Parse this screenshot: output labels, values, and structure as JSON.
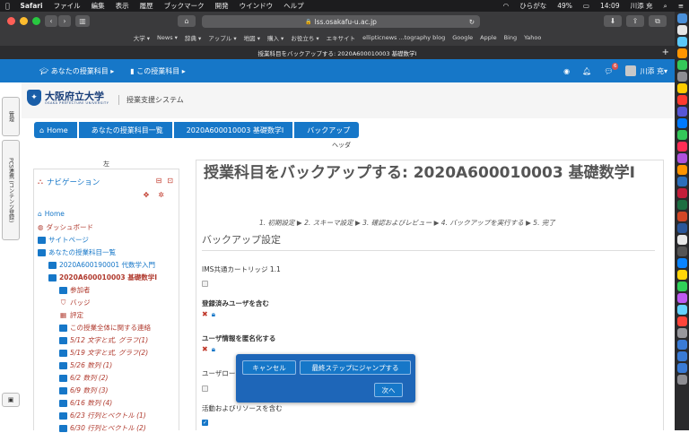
{
  "menubar": {
    "apple": "",
    "items": [
      "Safari",
      "ファイル",
      "編集",
      "表示",
      "履歴",
      "ブックマーク",
      "開発",
      "ウインドウ",
      "ヘルプ"
    ],
    "status": {
      "input": "ひらがな",
      "battery": "49%",
      "time": "14:09",
      "user": "川添 充"
    }
  },
  "browser": {
    "url": "lss.osakafu-u.ac.jp",
    "favorites": [
      "大学 ▾",
      "News ▾",
      "辞典 ▾",
      "アップル ▾",
      "地図 ▾",
      "購入 ▾",
      "お役立ち ▾",
      "エキサイト",
      "ellipticnews ...tography blog",
      "Google",
      "Apple",
      "Bing",
      "Yahoo"
    ],
    "tab_title": "授業科目をバックアップする: 2020A600010003 基礎数学I"
  },
  "navbar": {
    "my_courses": "あなたの授業科目",
    "this_course": "この授業科目",
    "message_badge": "6",
    "user": "川添 充"
  },
  "sidetabs": {
    "tab1": "管理",
    "tab2": "PCS連携 (コンテンツ登録)"
  },
  "site": {
    "logo_jp": "大阪府立大学",
    "logo_en": "OSAKA PREFECTURE UNIVERSITY",
    "system_name": "授業支援システム"
  },
  "breadcrumb": [
    "Home",
    "あなたの授業科目一覧",
    "2020A600010003 基礎数学I",
    "バックアップ"
  ],
  "labels": {
    "header": "ヘッダ",
    "left": "左"
  },
  "navigation": {
    "title": "ナビゲーション",
    "items": [
      {
        "label": "Home"
      },
      {
        "label": "ダッシュボード"
      },
      {
        "label": "サイトページ"
      },
      {
        "label": "あなたの授業科目一覧"
      },
      {
        "label": "2020A600190001 代数学入門"
      },
      {
        "label": "2020A600010003 基礎数学I"
      },
      {
        "label": "参加者"
      },
      {
        "label": "バッジ"
      },
      {
        "label": "評定"
      },
      {
        "label": "この授業全体に関する連絡"
      },
      {
        "label": "5/12 文字と式, グラフ(1)"
      },
      {
        "label": "5/19 文字と式, グラフ(2)"
      },
      {
        "label": "5/26 数列 (1)"
      },
      {
        "label": "6/2 数列 (2)"
      },
      {
        "label": "6/9 数列 (3)"
      },
      {
        "label": "6/16 数列 (4)"
      },
      {
        "label": "6/23 行列とベクトル (1)"
      },
      {
        "label": "6/30 行列とベクトル (2)"
      }
    ]
  },
  "main": {
    "title": "授業科目をバックアップする: 2020A600010003 基礎数学I",
    "steps": "1. 初期設定 ▶ 2. スキーマ設定 ▶ 3. 確認およびレビュー ▶ 4. バックアップを実行する ▶ 5. 完了",
    "section": "バックアップ設定",
    "fields": [
      {
        "label": "IMS共通カートリッジ 1.1"
      },
      {
        "label": "登録済みユーザを含む"
      },
      {
        "label": "ユーザ情報を匿名化する"
      },
      {
        "label": "ユーザロー"
      },
      {
        "label": "活動およびリソースを含む"
      }
    ]
  },
  "dialog": {
    "cancel": "キャンセル",
    "jump": "最終ステップにジャンプする",
    "next": "次へ"
  },
  "colors": {
    "accent": "#1677c8",
    "danger": "#c0392b",
    "link_red": "#b03a2e"
  }
}
